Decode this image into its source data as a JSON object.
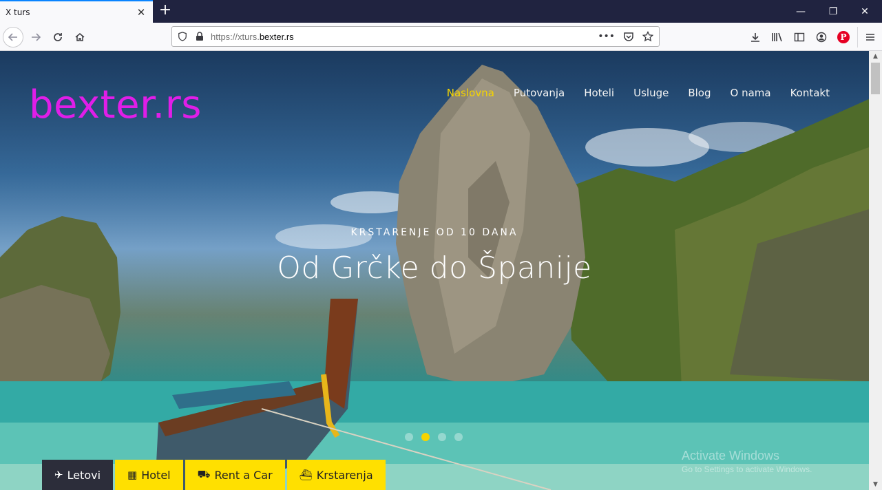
{
  "browser": {
    "tab_title": "X turs",
    "tab_close": "✕",
    "new_tab": "+",
    "url_scheme": "https://xturs.",
    "url_domain": "bexter.rs",
    "window_controls": {
      "minimize": "—",
      "restore": "❐",
      "close": "✕"
    }
  },
  "site": {
    "logo": "bexter.rs",
    "nav": [
      {
        "label": "Naslovna",
        "active": true
      },
      {
        "label": "Putovanja"
      },
      {
        "label": "Hoteli"
      },
      {
        "label": "Usluge"
      },
      {
        "label": "Blog"
      },
      {
        "label": "O nama"
      },
      {
        "label": "Kontakt"
      }
    ],
    "hero": {
      "subtitle": "KRSTARENJE OD 10 DANA",
      "title": "Od Grčke do Španije",
      "active_slide": 1,
      "slide_count": 4
    },
    "booking_tabs": [
      {
        "label": "Letovi",
        "icon": "plane-icon",
        "glyph": "✈"
      },
      {
        "label": "Hotel",
        "icon": "hotel-icon",
        "glyph": "▦"
      },
      {
        "label": "Rent a Car",
        "icon": "car-icon",
        "glyph": "⛟"
      },
      {
        "label": "Krstarenja",
        "icon": "ship-icon",
        "glyph": "⛴"
      }
    ]
  },
  "os_overlay": {
    "line1": "Activate Windows",
    "line2": "Go to Settings to activate Windows."
  },
  "colors": {
    "logo": "#e01ee8",
    "accent": "#f5d400",
    "tab_dark": "#2c2d3a",
    "tab_yellow": "#ffe000",
    "tabstrip": "#202340"
  }
}
